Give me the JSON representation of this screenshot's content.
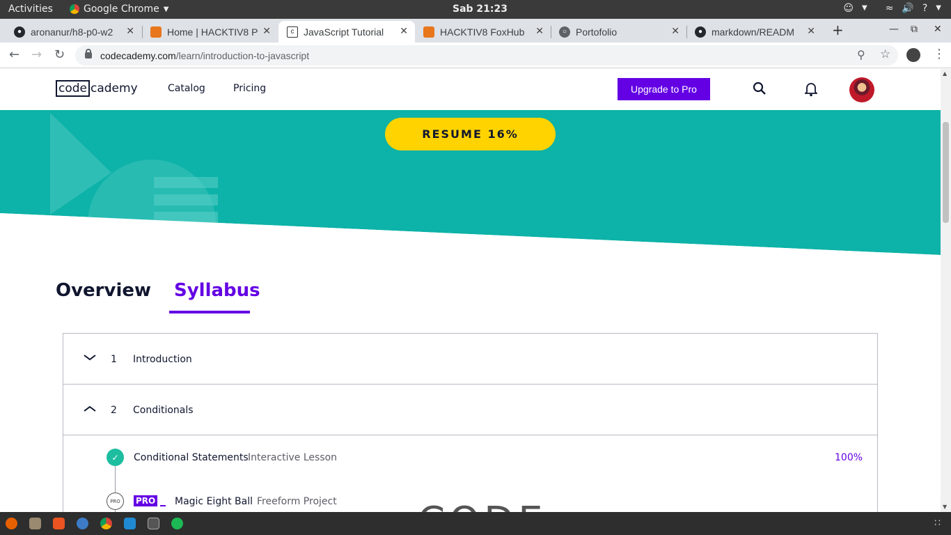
{
  "system": {
    "activities": "Activities",
    "app_name": "Google Chrome",
    "clock": "Sab 21:23"
  },
  "browser": {
    "tabs": [
      {
        "title": "aronanur/h8-p0-w2",
        "icon": "github-icon"
      },
      {
        "title": "Home | HACKTIV8 P",
        "icon": "hacktiv8-fox-icon"
      },
      {
        "title": "JavaScript Tutorial",
        "icon": "codecademy-icon"
      },
      {
        "title": "HACKTIV8 FoxHub",
        "icon": "hacktiv8-fox-icon"
      },
      {
        "title": "Portofolio",
        "icon": "globe-icon"
      },
      {
        "title": "markdown/READM",
        "icon": "github-icon"
      }
    ],
    "url_host": "codecademy.com",
    "url_path": "/learn/introduction-to-javascript"
  },
  "site": {
    "logo_box": "code",
    "logo_rest": "cademy",
    "nav": {
      "catalog": "Catalog",
      "pricing": "Pricing"
    },
    "upgrade_label": "Upgrade to Pro"
  },
  "hero": {
    "resume_label": "RESUME 16%",
    "progress_percent": 16
  },
  "tabs": {
    "overview": "Overview",
    "syllabus": "Syllabus",
    "active": "syllabus"
  },
  "syllabus": {
    "modules": [
      {
        "number": "1",
        "title": "Introduction",
        "expanded": false
      },
      {
        "number": "2",
        "title": "Conditionals",
        "expanded": true
      }
    ],
    "lessons": [
      {
        "title": "Conditional Statements",
        "type": "Interactive Lesson",
        "progress": "100%",
        "status": "complete"
      },
      {
        "title": "Magic Eight Ball",
        "type": "Freeform Project",
        "badge": "PRO",
        "status_label": "PRO"
      }
    ]
  },
  "dock": {
    "watermark": "CODE"
  },
  "colors": {
    "brand_purple": "#6400e4",
    "hero_teal": "#0db2a8",
    "resume_yellow": "#ffd300",
    "check_green": "#1dbda0"
  }
}
